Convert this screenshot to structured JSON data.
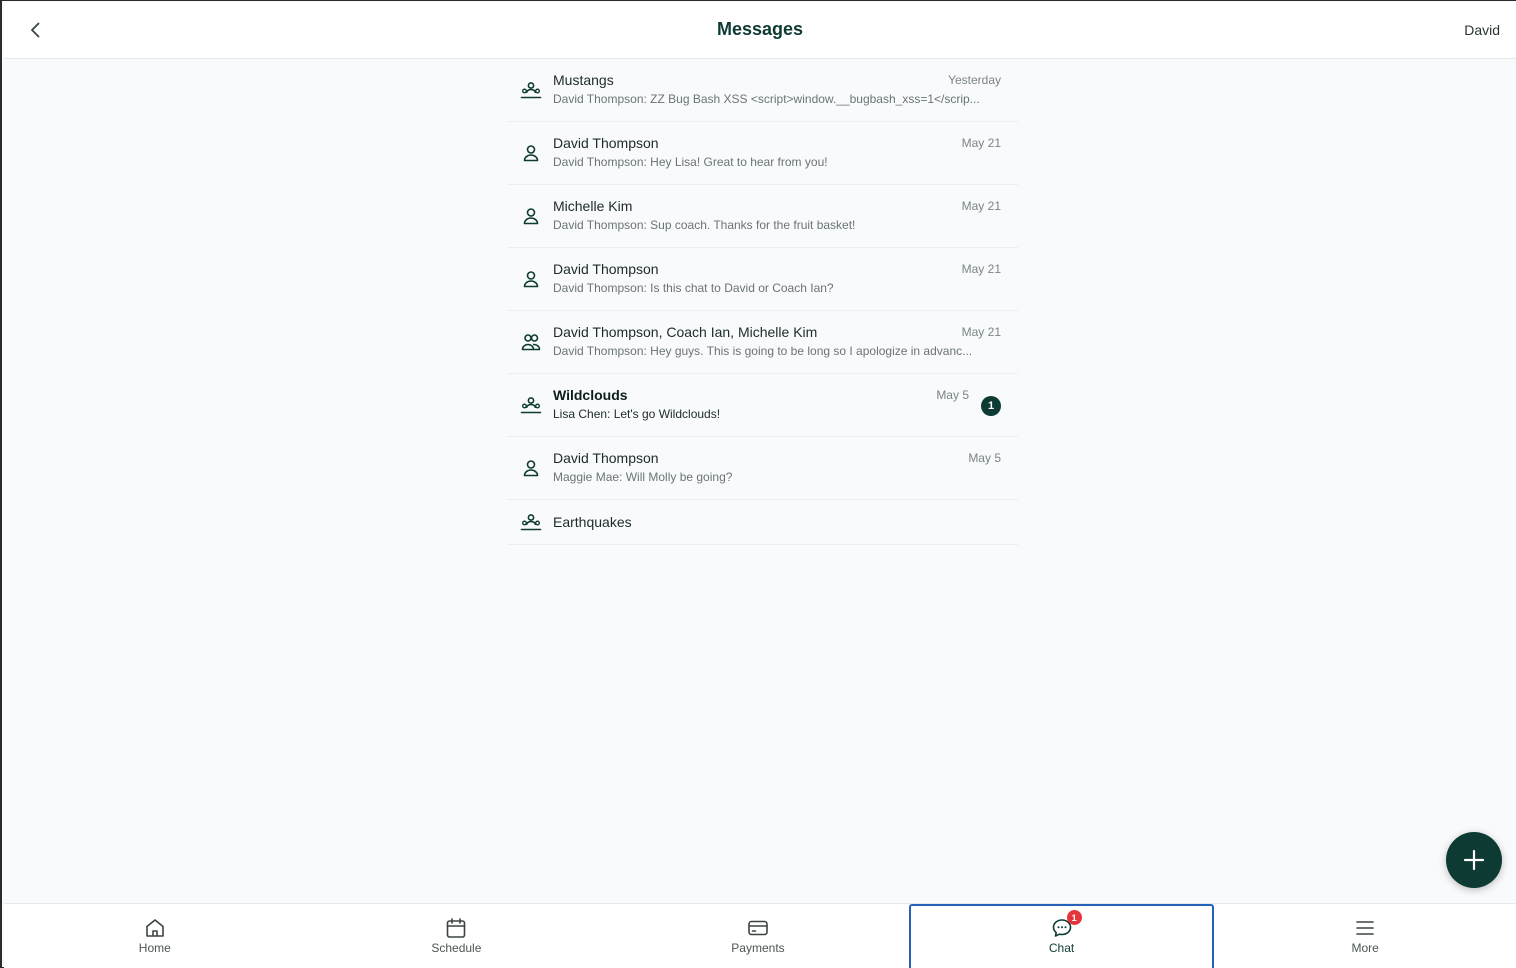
{
  "header": {
    "title": "Messages",
    "user_name": "David"
  },
  "conversations": [
    {
      "title": "Mustangs",
      "preview": "David Thompson: ZZ Bug Bash XSS <script>window.__bugbash_xss=1</scrip...",
      "time": "Yesterday",
      "icon": "team-icon",
      "unread": false
    },
    {
      "title": "David Thompson",
      "preview": "David Thompson: Hey Lisa! Great to hear from you!",
      "time": "May 21",
      "icon": "person-icon",
      "unread": false
    },
    {
      "title": "Michelle Kim",
      "preview": "David Thompson: Sup coach. Thanks for the fruit basket!",
      "time": "May 21",
      "icon": "person-icon",
      "unread": false
    },
    {
      "title": "David Thompson",
      "preview": "David Thompson: Is this chat to David or Coach Ian?",
      "time": "May 21",
      "icon": "person-icon",
      "unread": false
    },
    {
      "title": "David Thompson, Coach Ian, Michelle Kim",
      "preview": "David Thompson: Hey guys. This is going to be long so I apologize in advanc...",
      "time": "May 21",
      "icon": "group-icon",
      "unread": false
    },
    {
      "title": "Wildclouds",
      "preview": "Lisa Chen: Let's go Wildclouds!",
      "time": "May 5",
      "icon": "team-icon",
      "unread": true,
      "unread_count": "1"
    },
    {
      "title": "David Thompson",
      "preview": "Maggie Mae: Will Molly be going?",
      "time": "May 5",
      "icon": "person-icon",
      "unread": false
    },
    {
      "title": "Earthquakes",
      "preview": "",
      "time": "",
      "icon": "team-icon",
      "unread": false
    }
  ],
  "tabs": [
    {
      "label": "Home",
      "icon": "home-icon",
      "active": false
    },
    {
      "label": "Schedule",
      "icon": "calendar-icon",
      "active": false
    },
    {
      "label": "Payments",
      "icon": "card-icon",
      "active": false
    },
    {
      "label": "Chat",
      "icon": "chat-icon",
      "active": true,
      "badge": "1"
    },
    {
      "label": "More",
      "icon": "menu-icon",
      "active": false
    }
  ],
  "colors": {
    "brand": "#0d3b33",
    "badge_red": "#e5343b",
    "active_outline": "#2563b8"
  }
}
